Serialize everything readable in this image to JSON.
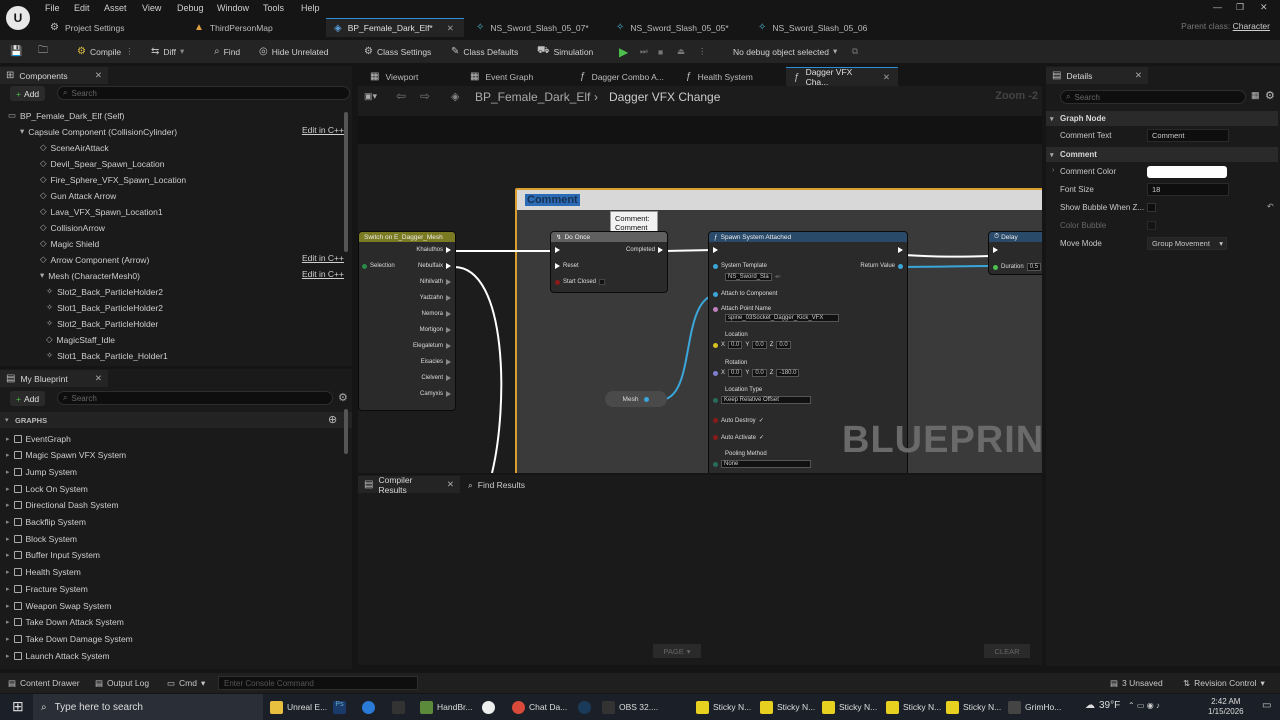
{
  "menu": [
    "File",
    "Edit",
    "Asset",
    "View",
    "Debug",
    "Window",
    "Tools",
    "Help"
  ],
  "tabs": [
    {
      "label": "Project Settings"
    },
    {
      "label": "ThirdPersonMap"
    },
    {
      "label": "BP_Female_Dark_Elf*",
      "active": true
    },
    {
      "label": "NS_Sword_Slash_05_07*"
    },
    {
      "label": "NS_Sword_Slash_05_05*"
    },
    {
      "label": "NS_Sword_Slash_05_06"
    }
  ],
  "parent_class": {
    "label": "Parent class:",
    "value": "Character"
  },
  "toolbar": {
    "compile": "Compile",
    "diff": "Diff",
    "find": "Find",
    "hide_unrelated": "Hide Unrelated",
    "class_settings": "Class Settings",
    "class_defaults": "Class Defaults",
    "simulation": "Simulation",
    "debug_object": "No debug object selected"
  },
  "components": {
    "title": "Components",
    "add": "Add",
    "search_placeholder": "Search",
    "items": [
      {
        "label": "BP_Female_Dark_Elf (Self)"
      },
      {
        "label": "Capsule Component (CollisionCylinder)",
        "edit": "Edit in C++"
      },
      {
        "label": "SceneAirAttack"
      },
      {
        "label": "Devil_Spear_Spawn_Location"
      },
      {
        "label": "Fire_Sphere_VFX_Spawn_Location"
      },
      {
        "label": "Gun Attack Arrow"
      },
      {
        "label": "Lava_VFX_Spawn_Location1"
      },
      {
        "label": "CollisionArrow"
      },
      {
        "label": "Magic Shield"
      },
      {
        "label": "Arrow Component (Arrow)",
        "edit": "Edit in C++"
      },
      {
        "label": "Mesh (CharacterMesh0)",
        "edit": "Edit in C++"
      },
      {
        "label": "Slot2_Back_ParticleHolder2"
      },
      {
        "label": "Slot1_Back_ParticleHolder2"
      },
      {
        "label": "Slot2_Back_ParticleHolder"
      },
      {
        "label": "MagicStaff_Idle"
      },
      {
        "label": "Slot1_Back_Particle_Holder1"
      }
    ]
  },
  "my_blueprint": {
    "title": "My Blueprint",
    "add": "Add",
    "search_placeholder": "Search",
    "graphs_header": "GRAPHS",
    "graphs": [
      "EventGraph",
      "Magic Spawn VFX System",
      "Jump System",
      "Lock On System",
      "Directional Dash System",
      "Backflip System",
      "Block System",
      "Buffer Input System",
      "Health System",
      "Fracture System",
      "Weapon Swap System",
      "Take Down Attack System",
      "Take Down Damage System",
      "Launch Attack System"
    ]
  },
  "graph_tabs": [
    "Viewport",
    "Event Graph",
    "Dagger Combo A...",
    "Health System",
    "Dagger VFX Cha..."
  ],
  "breadcrumb": {
    "root": "BP_Female_Dark_Elf",
    "current": "Dagger VFX Change",
    "zoom": "Zoom -2"
  },
  "graph": {
    "comment_title": "Comment",
    "tooltip": "Comment:\nComment",
    "switch_node": {
      "title": "Switch on E_Dagger_Mesh",
      "input": "Selection",
      "outputs": [
        "Khaiuthos",
        "Nebulfaix",
        "Nihilvath",
        "Yadzahn",
        "Nemora",
        "Mortigon",
        "Elegaletum",
        "Eisacies",
        "Cielvent",
        "Camyxis"
      ]
    },
    "do_once": {
      "title": "Do Once",
      "completed": "Completed",
      "reset": "Reset",
      "start_closed": "Start Closed"
    },
    "spawn": {
      "title": "Spawn System Attached",
      "system_template": "System Template",
      "template_value": "NS_Sword_Sla",
      "return_value": "Return Value",
      "attach": "Attach to Component",
      "attach_point": "Attach Point Name",
      "attach_point_value": "spine_03Socket_Dagger_Kick_VFX",
      "location": "Location",
      "loc": [
        "0.0",
        "0.0",
        "0.0"
      ],
      "rotation": "Rotation",
      "rot": [
        "0.0",
        "0.0",
        "-180.0"
      ],
      "location_type": "Location Type",
      "location_type_value": "Keep Relative Offset",
      "auto_destroy": "Auto Destroy",
      "auto_activate": "Auto Activate",
      "pooling": "Pooling Method",
      "pooling_value": "None"
    },
    "delay": {
      "title": "Delay",
      "duration": "Duration",
      "duration_value": "0.5"
    },
    "mesh": "Mesh",
    "watermark": "BLUEPRINT"
  },
  "bottom_tabs": {
    "compiler": "Compiler Results",
    "find": "Find Results",
    "page": "PAGE",
    "clear": "CLEAR"
  },
  "details": {
    "title": "Details",
    "search_placeholder": "Search",
    "graph_node_header": "Graph Node",
    "comment_text_label": "Comment Text",
    "comment_text_value": "Comment",
    "comment_header": "Comment",
    "comment_color": "Comment Color",
    "font_size": "Font Size",
    "font_size_value": "18",
    "show_bubble": "Show Bubble When Z...",
    "color_bubble": "Color Bubble",
    "move_mode": "Move Mode",
    "move_mode_value": "Group Movement"
  },
  "status": {
    "content_drawer": "Content Drawer",
    "output_log": "Output Log",
    "cmd": "Cmd",
    "console_placeholder": "Enter Console Command",
    "unsaved": "3 Unsaved",
    "revision": "Revision Control"
  },
  "taskbar": {
    "search": "Type here to search",
    "apps": [
      "HandBr...",
      "Chat Da...",
      "OBS 32....",
      "Sticky N...",
      "Sticky N...",
      "Sticky N...",
      "Sticky N...",
      "Sticky N...",
      "GrimHo..."
    ],
    "unreal": "Unreal E...",
    "weather": "39°F",
    "time": "2:42 AM",
    "date": "1/15/2026"
  }
}
